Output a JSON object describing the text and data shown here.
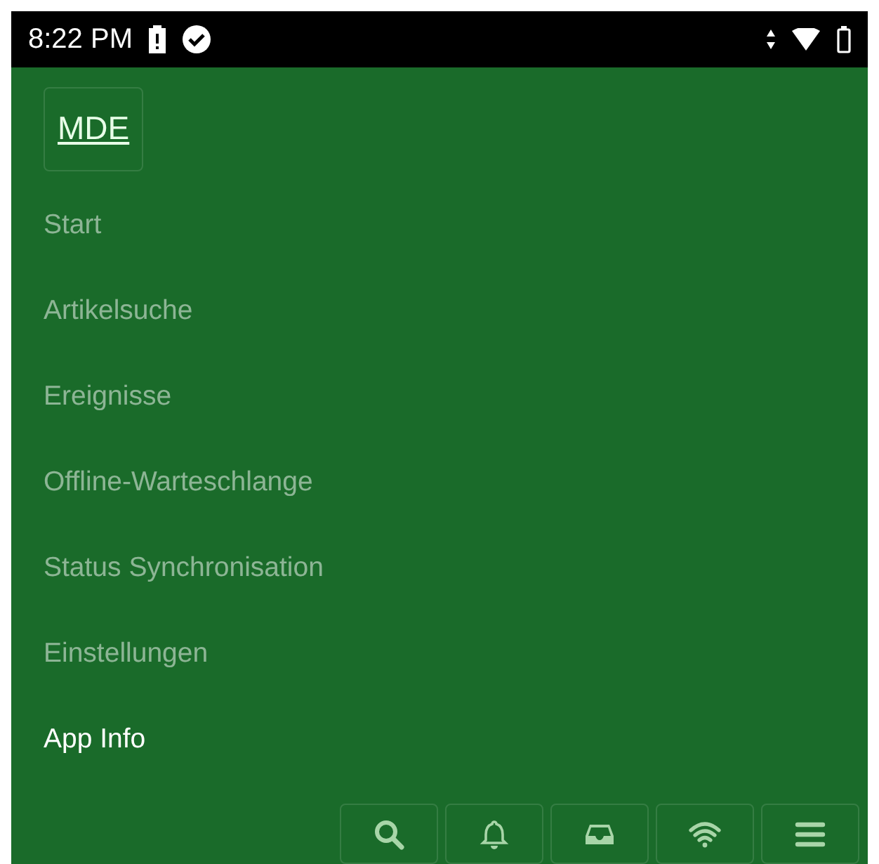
{
  "status_bar": {
    "time": "8:22 PM"
  },
  "brand": "MDE",
  "menu": [
    {
      "label": "Start",
      "selected": false
    },
    {
      "label": "Artikelsuche",
      "selected": false
    },
    {
      "label": "Ereignisse",
      "selected": false
    },
    {
      "label": "Offline-Warteschlange",
      "selected": false
    },
    {
      "label": "Status Synchronisation",
      "selected": false
    },
    {
      "label": "Einstellungen",
      "selected": false
    },
    {
      "label": "App Info",
      "selected": true
    }
  ],
  "toolbar": [
    {
      "kind": "search"
    },
    {
      "kind": "bell"
    },
    {
      "kind": "inbox"
    },
    {
      "kind": "wifi"
    },
    {
      "kind": "menu"
    }
  ]
}
